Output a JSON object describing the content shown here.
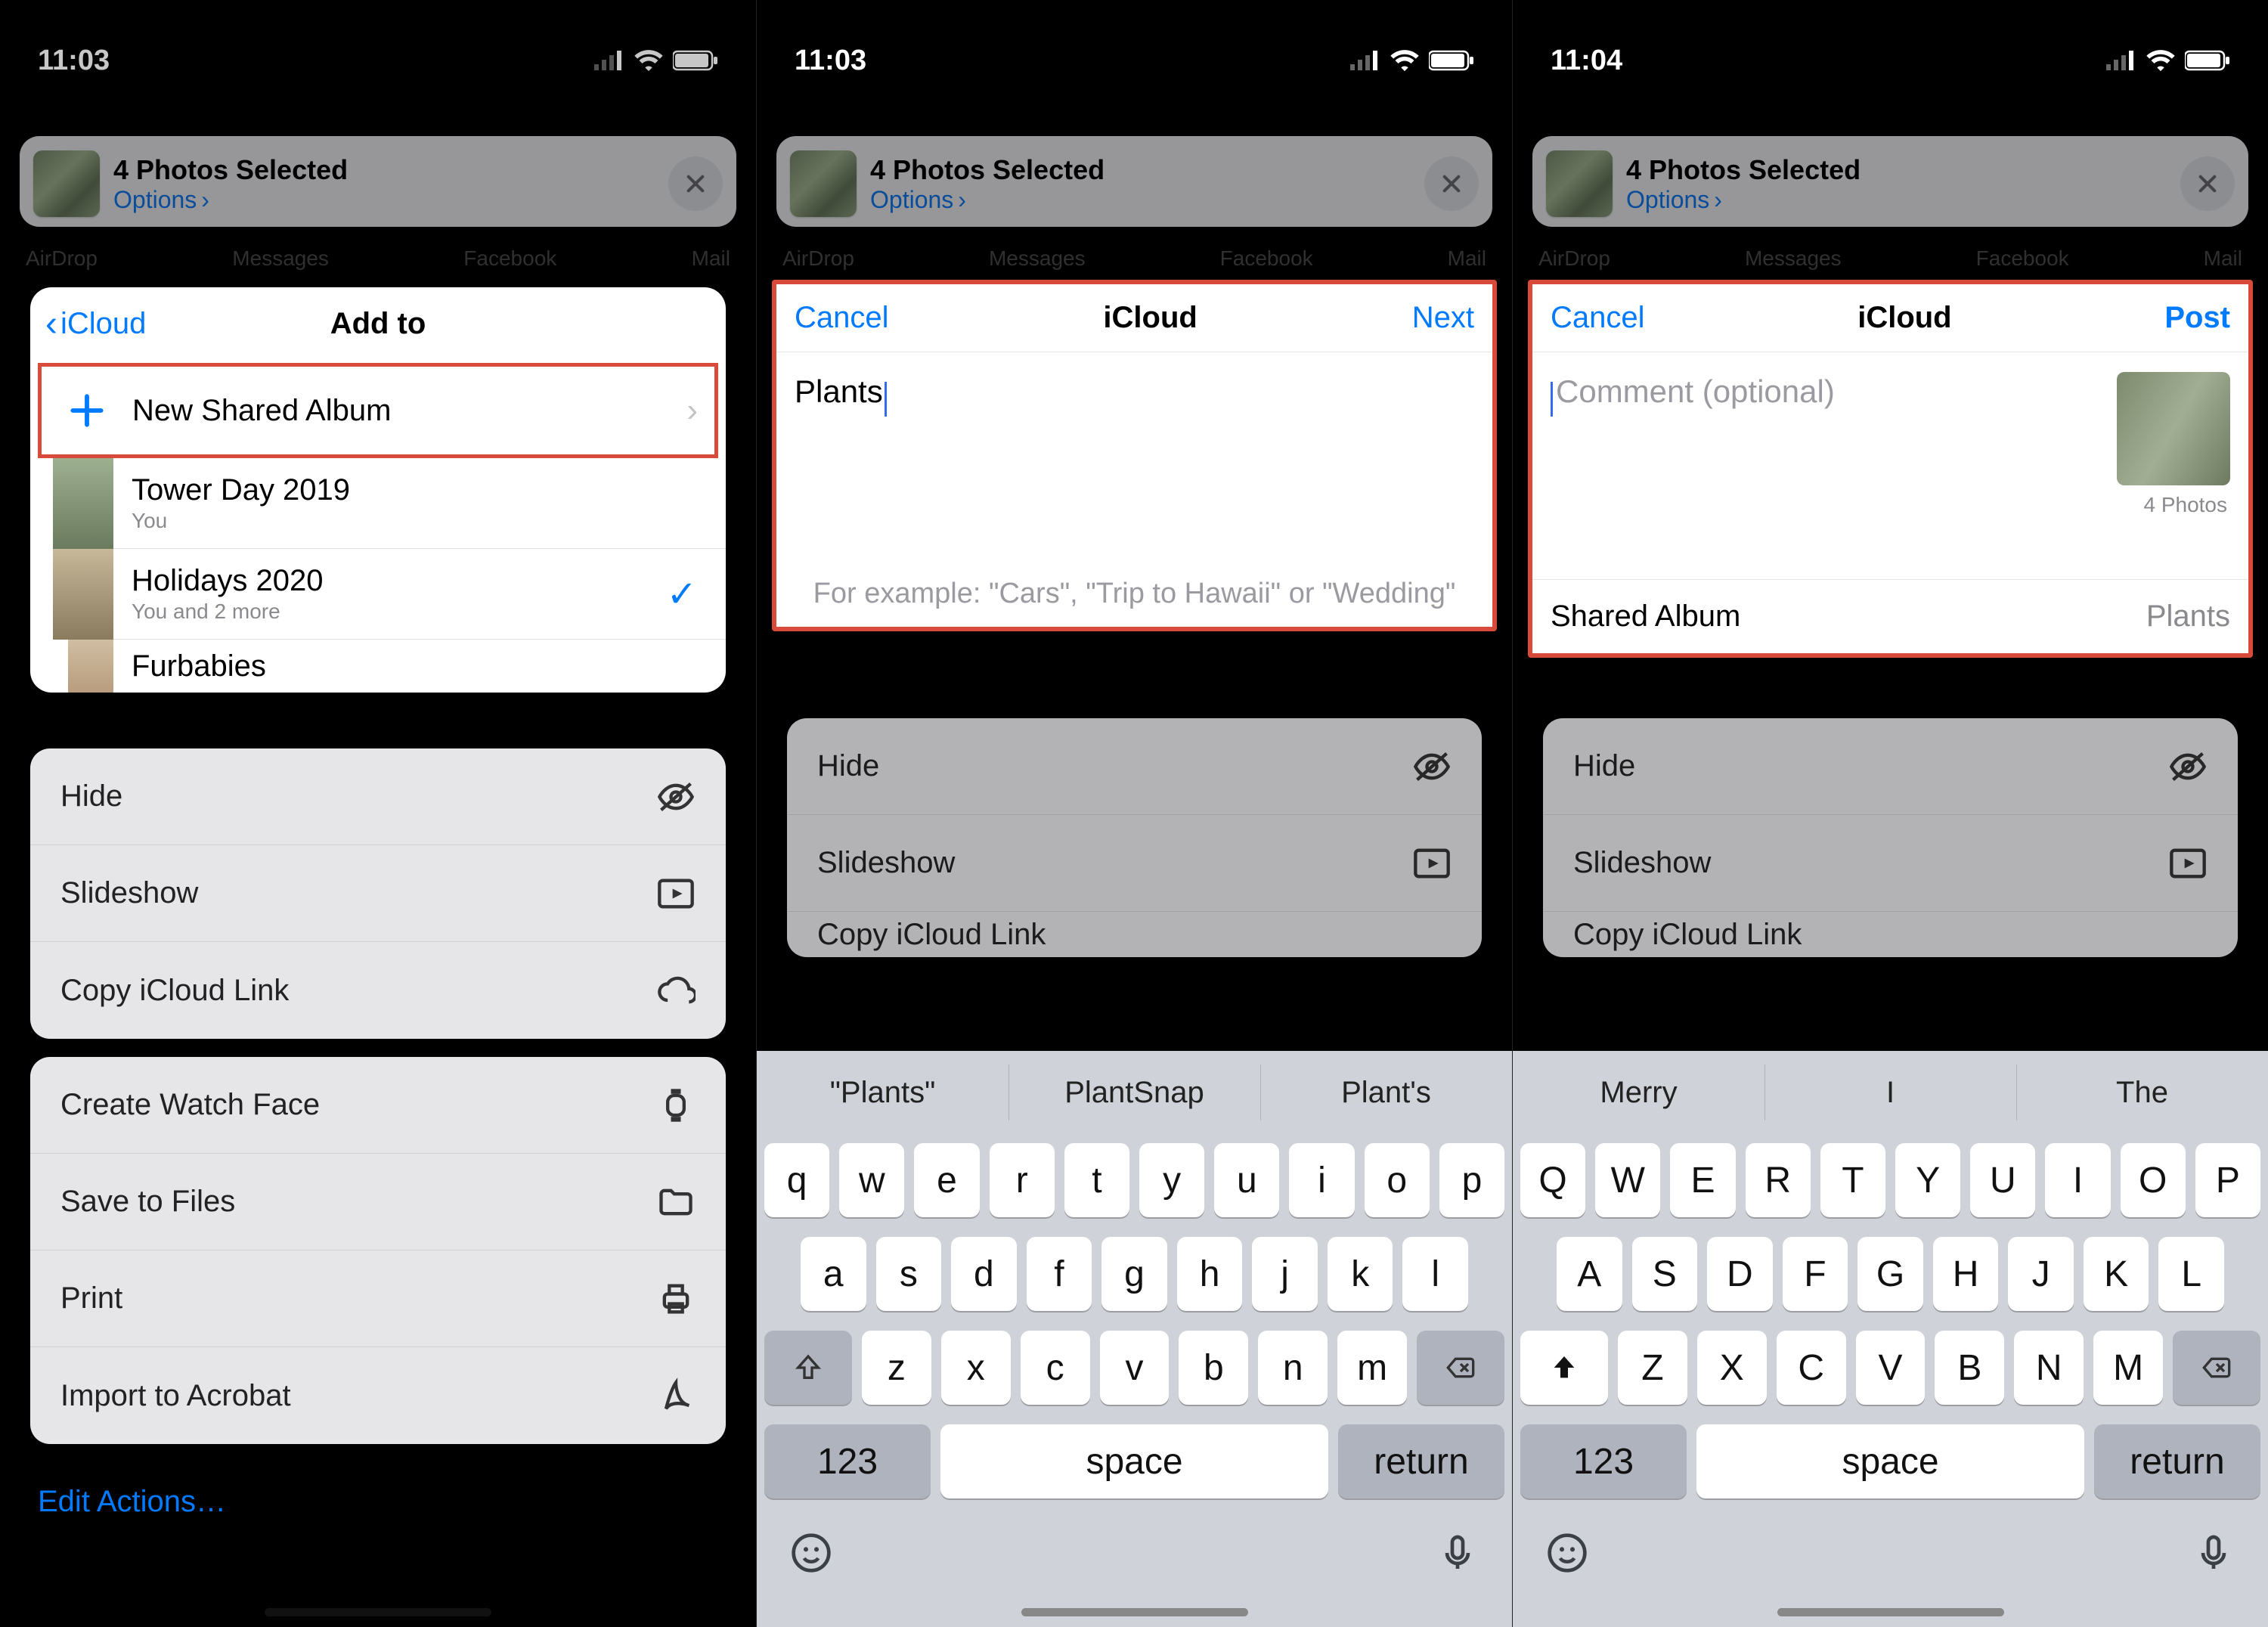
{
  "screen1": {
    "time": "11:03",
    "share": {
      "title": "4 Photos Selected",
      "options": "Options"
    },
    "apps": [
      "AirDrop",
      "Messages",
      "Facebook",
      "Mail"
    ],
    "sheet": {
      "back": "iCloud",
      "title": "Add to",
      "newAlbum": "New Shared Album",
      "albums": [
        {
          "title": "Tower Day 2019",
          "sub": "You",
          "checked": false
        },
        {
          "title": "Holidays 2020",
          "sub": "You and 2 more",
          "checked": true
        },
        {
          "title": "Furbabies",
          "sub": "",
          "checked": false
        }
      ]
    },
    "actions1": [
      "Hide",
      "Slideshow",
      "Copy iCloud Link"
    ],
    "actions2": [
      "Create Watch Face",
      "Save to Files",
      "Print",
      "Import to Acrobat"
    ],
    "edit": "Edit Actions…"
  },
  "screen2": {
    "time": "11:03",
    "share": {
      "title": "4 Photos Selected",
      "options": "Options"
    },
    "apps": [
      "AirDrop",
      "Messages",
      "Facebook",
      "Mail"
    ],
    "panel": {
      "left": "Cancel",
      "title": "iCloud",
      "right": "Next",
      "text": "Plants",
      "example": "For example: \"Cars\", \"Trip to Hawaii\" or \"Wedding\""
    },
    "actions1": [
      "Hide",
      "Slideshow",
      "Copy iCloud Link"
    ],
    "predict": [
      "\"Plants\"",
      "PlantSnap",
      "Plant's"
    ],
    "row1": [
      "q",
      "w",
      "e",
      "r",
      "t",
      "y",
      "u",
      "i",
      "o",
      "p"
    ],
    "row2": [
      "a",
      "s",
      "d",
      "f",
      "g",
      "h",
      "j",
      "k",
      "l"
    ],
    "row3": [
      "z",
      "x",
      "c",
      "v",
      "b",
      "n",
      "m"
    ],
    "numkey": "123",
    "space": "space",
    "ret": "return"
  },
  "screen3": {
    "time": "11:04",
    "share": {
      "title": "4 Photos Selected",
      "options": "Options"
    },
    "apps": [
      "AirDrop",
      "Messages",
      "Facebook",
      "Mail"
    ],
    "panel": {
      "left": "Cancel",
      "title": "iCloud",
      "right": "Post",
      "placeholder": "Comment (optional)",
      "photocount": "4 Photos",
      "sharedLabel": "Shared Album",
      "sharedValue": "Plants"
    },
    "actions1": [
      "Hide",
      "Slideshow",
      "Copy iCloud Link"
    ],
    "predict": [
      "Merry",
      "I",
      "The"
    ],
    "row1": [
      "Q",
      "W",
      "E",
      "R",
      "T",
      "Y",
      "U",
      "I",
      "O",
      "P"
    ],
    "row2": [
      "A",
      "S",
      "D",
      "F",
      "G",
      "H",
      "J",
      "K",
      "L"
    ],
    "row3": [
      "Z",
      "X",
      "C",
      "V",
      "B",
      "N",
      "M"
    ],
    "numkey": "123",
    "space": "space",
    "ret": "return"
  }
}
